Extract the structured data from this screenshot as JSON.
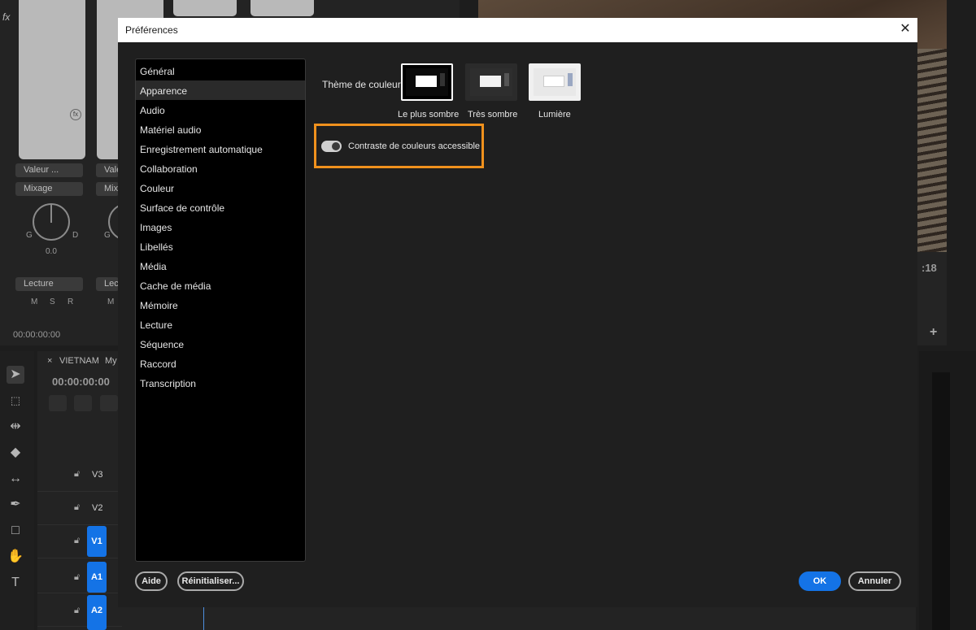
{
  "background": {
    "mixer": {
      "channel_dropdowns": [
        "Valeur ...",
        "Mixage"
      ],
      "channel2_dropdowns": [
        "Vale",
        "Mix"
      ],
      "pan_left": "G",
      "pan_right": "D",
      "pan_value": "0.0",
      "mode_dropdown": "Lecture",
      "mode_dropdown2": "Lect",
      "msr": [
        "M",
        "S",
        "R"
      ],
      "timecode": "00:00:00:00"
    },
    "preview": {
      "timecode_partial": ":18"
    },
    "timeline": {
      "tab_title": "VIETNAM",
      "tab_title2": "My",
      "timecode": "00:00:00:00",
      "tracks": [
        "V3",
        "V2",
        "V1",
        "A1",
        "A2"
      ]
    }
  },
  "dialog": {
    "title": "Préférences",
    "categories": [
      "Général",
      "Apparence",
      "Audio",
      "Matériel audio",
      "Enregistrement automatique",
      "Collaboration",
      "Couleur",
      "Surface de contrôle",
      "Images",
      "Libellés",
      "Média",
      "Cache de média",
      "Mémoire",
      "Lecture",
      "Séquence",
      "Raccord",
      "Transcription"
    ],
    "selected_category": "Apparence",
    "theme": {
      "label": "Thème de couleur",
      "options": [
        "Le plus sombre",
        "Très sombre",
        "Lumière"
      ],
      "selected": "Le plus sombre"
    },
    "accessible_contrast": {
      "label": "Contraste de couleurs accessible",
      "enabled": true
    },
    "buttons": {
      "help": "Aide",
      "reset": "Réinitialiser...",
      "ok": "OK",
      "cancel": "Annuler"
    },
    "highlight_color": "#f0911d",
    "accent_color": "#1473e6"
  }
}
